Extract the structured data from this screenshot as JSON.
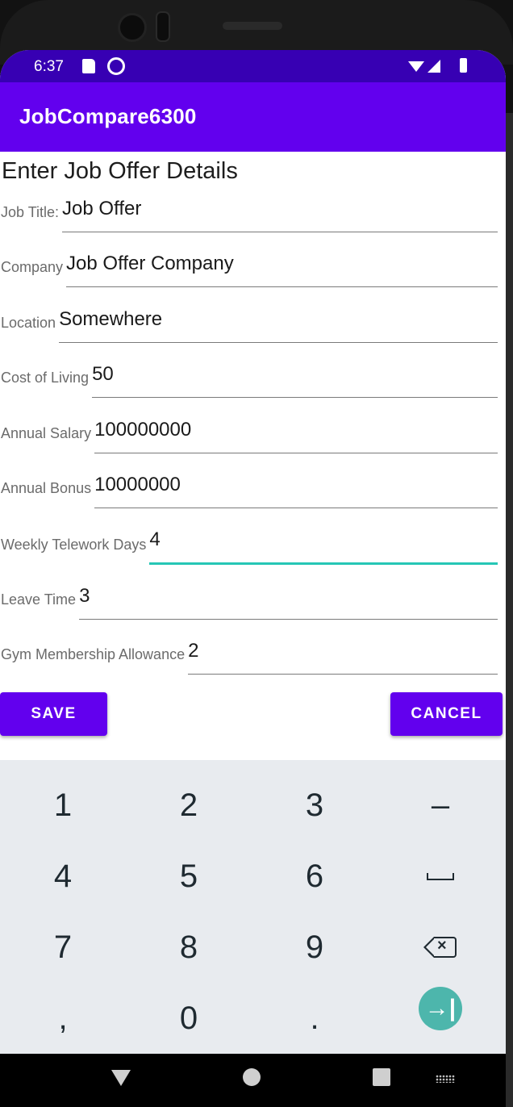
{
  "status_bar": {
    "time": "6:37",
    "icons": [
      "sd-card-icon",
      "sync-icon",
      "wifi-icon",
      "signal-icon",
      "battery-icon"
    ]
  },
  "app_bar": {
    "title": "JobCompare6300"
  },
  "form": {
    "heading": "Enter Job Offer Details",
    "fields": [
      {
        "label": "Job Title:",
        "value": "Job Offer"
      },
      {
        "label": "Company",
        "value": "Job Offer Company"
      },
      {
        "label": "Location",
        "value": "Somewhere"
      },
      {
        "label": "Cost of Living",
        "value": "50"
      },
      {
        "label": "Annual Salary",
        "value": "100000000"
      },
      {
        "label": "Annual Bonus",
        "value": "10000000"
      },
      {
        "label": "Weekly Telework Days",
        "value": "4",
        "focused": true
      },
      {
        "label": "Leave Time",
        "value": "3"
      },
      {
        "label": "Gym Membership Allowance",
        "value": "2"
      }
    ],
    "save_label": "SAVE",
    "cancel_label": "CANCEL"
  },
  "keyboard": {
    "keys": [
      "1",
      "2",
      "3",
      "–",
      "4",
      "5",
      "6",
      "",
      "7",
      "8",
      "9",
      "",
      ",",
      "0",
      ".",
      ""
    ],
    "special_icons": {
      "space": "space-icon",
      "backspace": "backspace-icon",
      "next": "next-field-icon"
    }
  },
  "nav_bar": {
    "icons": [
      "back-icon",
      "home-icon",
      "recents-icon",
      "keyboard-switch-icon"
    ]
  },
  "colors": {
    "status_bar": "#3700b3",
    "primary": "#6200ee",
    "focus_underline": "#26c6b5",
    "keyboard_bg": "#e8ebef",
    "next_key": "#4db6ac"
  }
}
